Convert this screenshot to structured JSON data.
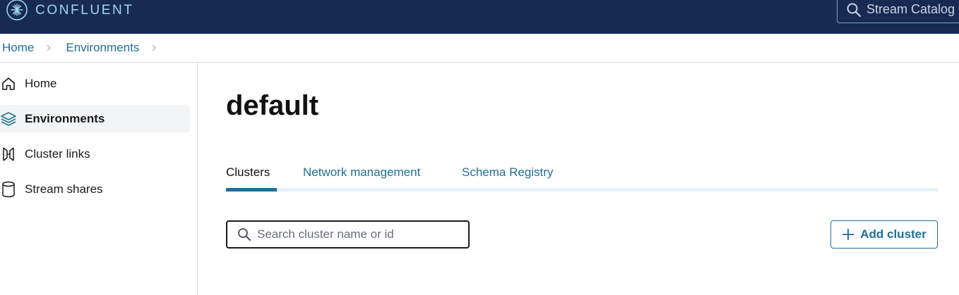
{
  "header": {
    "brand": "CONFLUENT",
    "search_label": "Stream Catalog",
    "logo_icon": "confluent-burst-icon",
    "colors": {
      "background": "#172a52",
      "brand_text": "#9fd6ea"
    }
  },
  "breadcrumb": {
    "items": [
      "Home",
      "Environments"
    ]
  },
  "sidebar": {
    "items": [
      {
        "label": "Home",
        "icon": "home-icon",
        "active": false
      },
      {
        "label": "Environments",
        "icon": "layers-icon",
        "active": true
      },
      {
        "label": "Cluster links",
        "icon": "cluster-links-icon",
        "active": false
      },
      {
        "label": "Stream shares",
        "icon": "database-icon",
        "active": false
      }
    ]
  },
  "main": {
    "title": "default",
    "tabs": [
      {
        "label": "Clusters",
        "active": true
      },
      {
        "label": "Network management",
        "active": false
      },
      {
        "label": "Schema Registry",
        "active": false
      }
    ],
    "search": {
      "placeholder": "Search cluster name or id",
      "value": ""
    },
    "add_button_label": "Add cluster"
  },
  "colors": {
    "accent": "#1f6f99",
    "tab_track": "#e6f1f7"
  }
}
